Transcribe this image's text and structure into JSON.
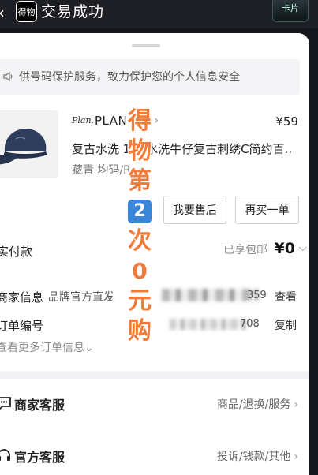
{
  "header": {
    "back_glyph": "‹",
    "logo_text": "得物",
    "title": "交易成功",
    "card_label": "卡片"
  },
  "notice": {
    "text": "供号码保护服务，致力保护您的个人信息安全",
    "icon": "speaker-icon"
  },
  "product": {
    "brand": "PLAN IN",
    "brand_logo_text": "Plan.",
    "price": "¥59",
    "title": "复古水洗 1 做水洗牛仔复古刺绣C简约百...",
    "spec": "藏青 均码/R"
  },
  "buttons": {
    "after_sale": "我要售后",
    "buy_again": "再买一单"
  },
  "payment": {
    "label": "实付款",
    "shipping": "已享包邮",
    "amount": "¥0"
  },
  "merchant": {
    "label": "商家信息",
    "value": "品牌官方直发",
    "number_tail": "359",
    "view": "查看"
  },
  "order": {
    "label": "订单编号",
    "number_tail": "708",
    "copy": "复制",
    "more": "查看更多订单信息"
  },
  "services": {
    "merchant": {
      "label": "商家客服",
      "right": "商品/退换/服务"
    },
    "official": {
      "label": "官方客服",
      "right": "投诉/钱款/其他"
    }
  },
  "promo": {
    "chars_top": [
      "得",
      "物",
      "第"
    ],
    "number": "2",
    "chars_bottom": [
      "次",
      "0",
      "元",
      "购"
    ]
  },
  "colors": {
    "accent": "#f07b3a",
    "badge_blue": "#3a86d8"
  }
}
